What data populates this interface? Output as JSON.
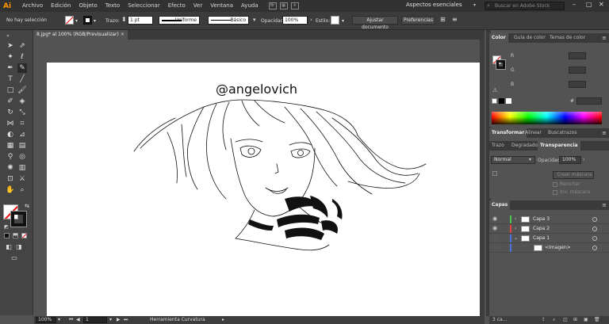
{
  "app": {
    "logo": "Ai",
    "workspace": "Aspectos esenciales",
    "search_placeholder": "Buscar en Adobe Stock",
    "bridge_icon": "Br"
  },
  "menu": [
    "Archivo",
    "Edición",
    "Objeto",
    "Texto",
    "Seleccionar",
    "Efecto",
    "Ver",
    "Ventana",
    "Ayuda"
  ],
  "control": {
    "selection": "No hay selección",
    "stroke_label": "Trazo:",
    "stroke_weight": "1 pt",
    "profile_label": "Uniforme",
    "brush_label": "Básico",
    "opacity_label": "Opacidad:",
    "opacity_value": "100%",
    "style_label": "Estilo:",
    "doc_setup": "Ajustar documento",
    "preferences": "Preferencias"
  },
  "document": {
    "tab_title": "8.jpg* al 100% (RGB/Previsualizar)",
    "watermark": "@angelovich"
  },
  "status": {
    "zoom": "100%",
    "artboard": "1",
    "tool": "Herramienta Curvatura"
  },
  "color_panel": {
    "tabs": [
      "Color",
      "Guía de color",
      "Temas de color"
    ],
    "channels": [
      "R",
      "G",
      "B"
    ],
    "hex_label": "#"
  },
  "transform_panel": {
    "tabs": [
      "Transformar",
      "Alinear",
      "Buscatrazos"
    ],
    "subtabs": [
      "Trazo",
      "Degradado",
      "Transparencia"
    ],
    "blend_mode": "Normal",
    "opacity_label": "Opacidad:",
    "opacity_value": "100%",
    "make_mask": "Crear máscara",
    "clip": "Recortar",
    "invert_mask": "Inv. máscara"
  },
  "layers_panel": {
    "tab": "Capas",
    "layers": [
      {
        "name": "Capa 3",
        "color": "#4fc34f"
      },
      {
        "name": "Capa 2",
        "color": "#e04646"
      },
      {
        "name": "Capa 1",
        "color": "#4a6fe0"
      },
      {
        "name": "<Imagen>",
        "color": "#4a6fe0"
      }
    ],
    "footer": "3 ca..."
  }
}
